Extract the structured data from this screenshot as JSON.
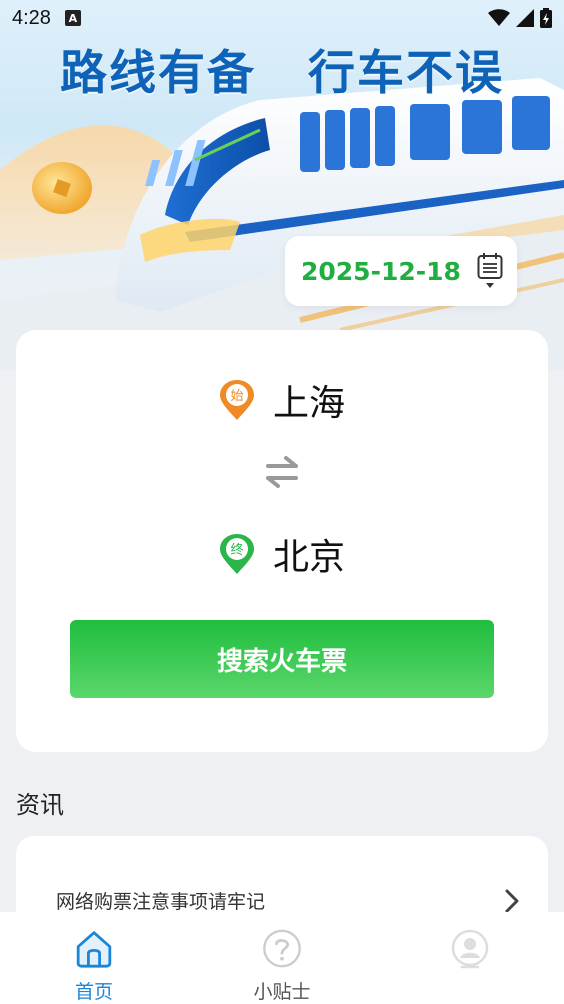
{
  "status_bar": {
    "time": "4:28",
    "indicator": "A"
  },
  "hero": {
    "slogan_left": "路线有备",
    "slogan_right": "行车不误"
  },
  "date": {
    "value": "2025-12-18",
    "icon": "calendar-icon"
  },
  "route": {
    "from_badge": "始",
    "from_station": "上海",
    "to_badge": "终",
    "to_station": "北京",
    "search_label": "搜索火车票"
  },
  "news": {
    "title": "资讯",
    "items": [
      {
        "text": "网络购票注意事项请牢记"
      }
    ]
  },
  "tabs": [
    {
      "label": "首页",
      "icon": "home-icon",
      "active": true
    },
    {
      "label": "小贴士",
      "icon": "question-icon",
      "active": false
    },
    {
      "label": "",
      "icon": "profile-icon",
      "active": false
    }
  ],
  "colors": {
    "accent_green": "#1fae3f",
    "slogan_blue": "#0e63b8",
    "tab_active": "#1a86d8",
    "from_pin": "#f08a24",
    "to_pin": "#2bb64c"
  }
}
